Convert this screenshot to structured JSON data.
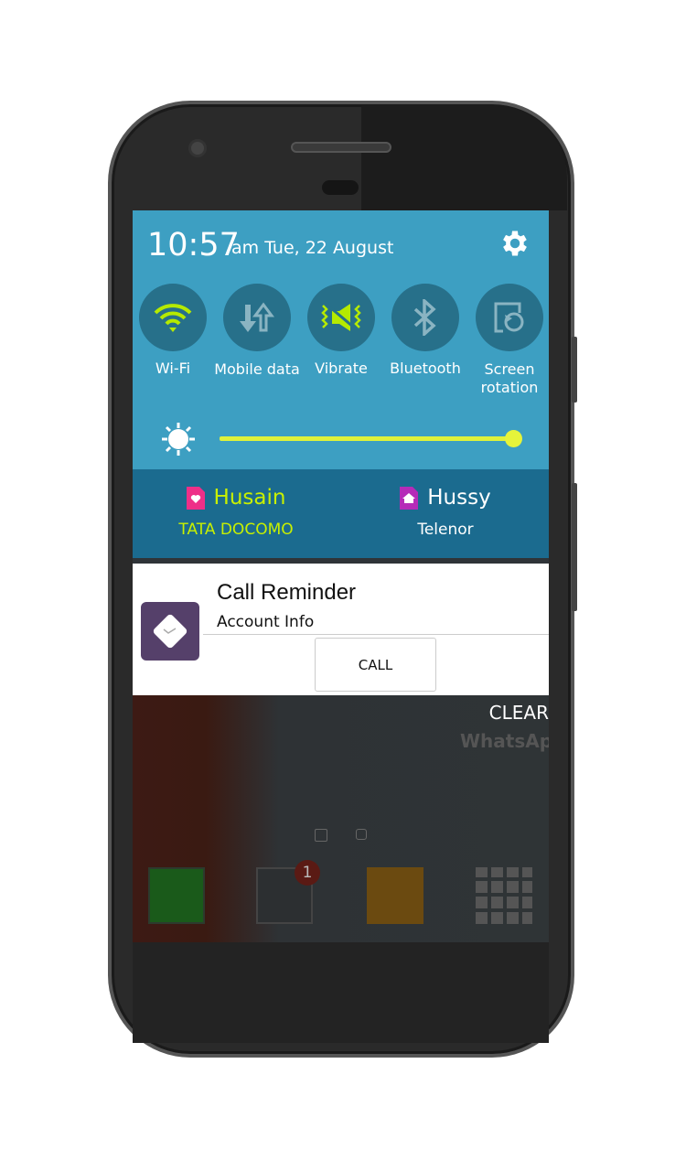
{
  "status": {
    "time": "10:57",
    "date": "am Tue, 22 August",
    "settings_icon": "gear-icon"
  },
  "toggles": [
    {
      "label": "Wi-Fi",
      "icon": "wifi-icon",
      "active": true
    },
    {
      "label": "Mobile data",
      "icon": "mobile-data-icon",
      "active": false
    },
    {
      "label": "Vibrate",
      "icon": "vibrate-icon",
      "active": true
    },
    {
      "label": "Bluetooth",
      "icon": "bluetooth-icon",
      "active": false
    },
    {
      "label": "Screen rotation",
      "icon": "screen-rotation-icon",
      "active": false
    }
  ],
  "brightness": {
    "level_percent": 100
  },
  "sims": [
    {
      "name": "Husain",
      "operator": "TATA DOCOMO",
      "color": "#c8f000",
      "icon_color": "#ee2f88"
    },
    {
      "name": "Hussy",
      "operator": "Telenor",
      "color": "#ffffff",
      "icon_color": "#b52bb8"
    }
  ],
  "notification": {
    "title": "Call Reminder",
    "subtitle": "Account Info",
    "action": "CALL"
  },
  "clear_label": "CLEAR",
  "home": {
    "whatsapp_label": "WhatsApp",
    "message_badge": "1"
  },
  "colors": {
    "panel": "#3d9fc2",
    "sim_bar": "#1b6b8f",
    "accent": "#c8f000"
  }
}
